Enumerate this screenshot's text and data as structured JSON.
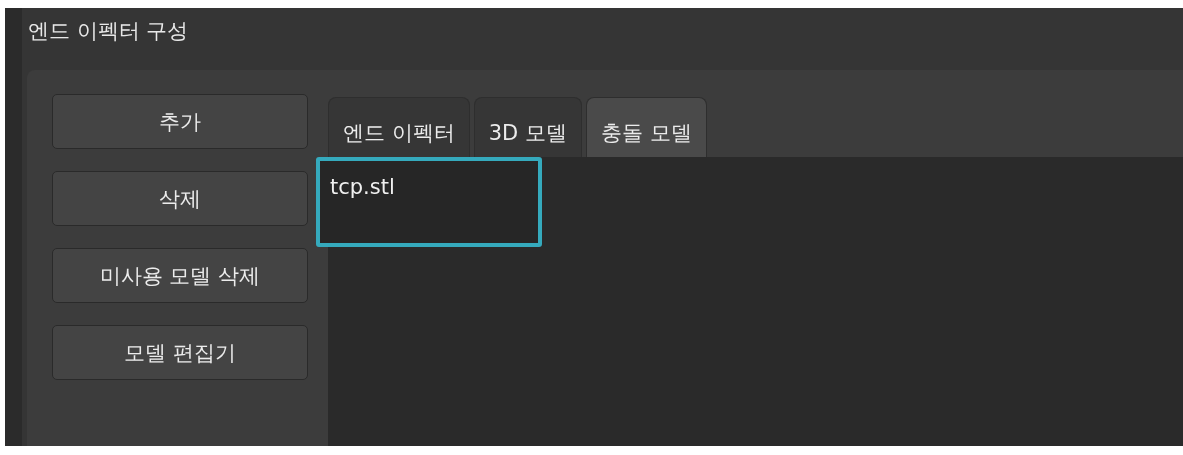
{
  "window": {
    "title": "엔드 이펙터 구성"
  },
  "buttons": [
    "추가",
    "삭제",
    "미사용 모델 삭제",
    "모델 편집기"
  ],
  "tabs": [
    {
      "label": "엔드 이펙터",
      "selected": false
    },
    {
      "label": "3D 모델",
      "selected": false
    },
    {
      "label": "충돌 모델",
      "selected": true
    }
  ],
  "files": [
    {
      "name": "tcp.stl",
      "outlined": true
    }
  ]
}
